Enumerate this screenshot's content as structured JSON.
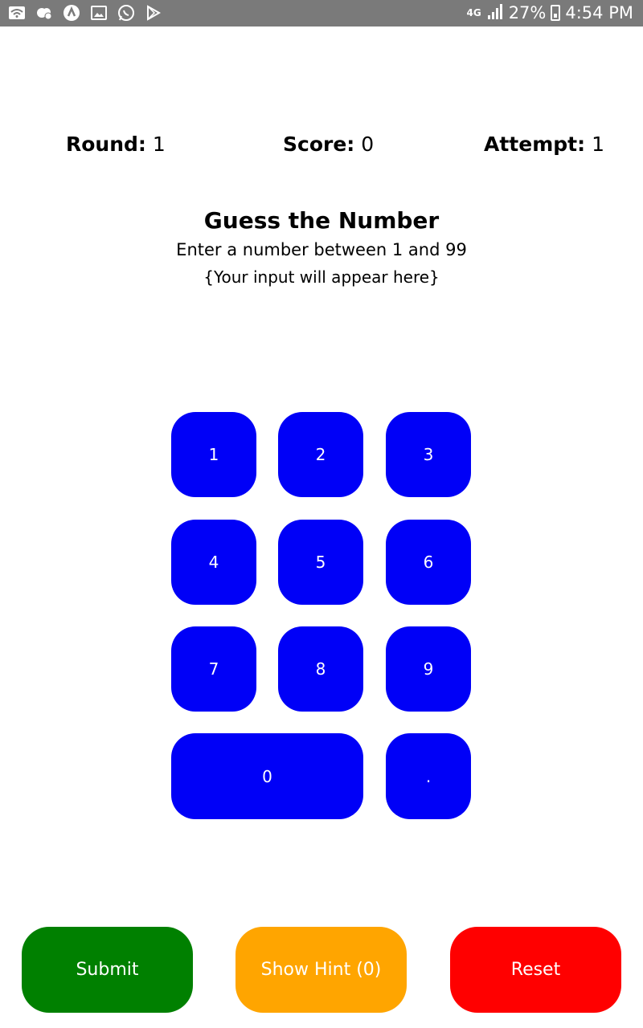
{
  "status_bar": {
    "icons": [
      "wifi-icon",
      "cloud-icon",
      "android-icon",
      "gallery-icon",
      "whatsapp-icon",
      "play-store-icon"
    ],
    "network": "4G",
    "battery": "27%",
    "time": "4:54 PM"
  },
  "stats": {
    "round_label": "Round:",
    "round_value": "1",
    "score_label": "Score:",
    "score_value": "0",
    "attempt_label": "Attempt:",
    "attempt_value": "1"
  },
  "header": {
    "title": "Guess the Number",
    "subtitle": "Enter a number between 1 and 99",
    "input_placeholder": "{Your input will appear here}"
  },
  "keypad": {
    "keys": [
      "1",
      "2",
      "3",
      "4",
      "5",
      "6",
      "7",
      "8",
      "9",
      "0",
      "."
    ],
    "color": "#0000f7"
  },
  "actions": {
    "submit": "Submit",
    "hint": "Show Hint (0)",
    "reset": "Reset",
    "submit_color": "#008000",
    "hint_color": "#ffa500",
    "reset_color": "#ff0000"
  }
}
